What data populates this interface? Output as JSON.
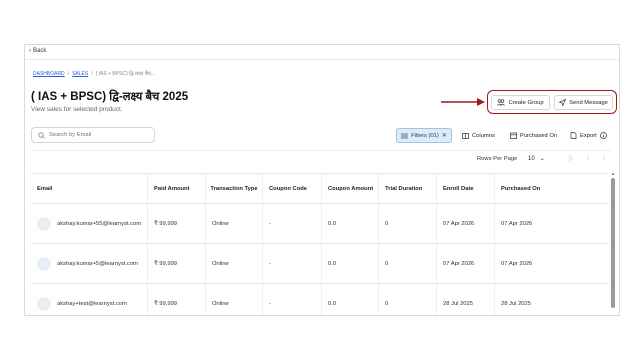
{
  "nav": {
    "back_label": "Back"
  },
  "breadcrumb": {
    "item1": "DASHBOARD",
    "sep1": "/",
    "item2": "SALES",
    "sep2": "/",
    "item3": "( IAS + BPSC) द्वि-लक्ष्य बैच..."
  },
  "page": {
    "title": "( IAS + BPSC) द्वि-लक्ष्य बैच 2025",
    "subtitle": "View sales for selected product."
  },
  "actions": {
    "create_group": "Create Group",
    "send_message": "Send Message"
  },
  "toolbar": {
    "search_placeholder": "Search by Email",
    "filters_label": "Filters (01)",
    "columns_label": "Columns",
    "purchased_on_label": "Purchased On",
    "export_label": "Export"
  },
  "pagination": {
    "rows_per_page_label": "Rows Per Page",
    "rows_per_page_value": "10"
  },
  "table": {
    "headers": [
      "Email",
      "Paid Amount",
      "Transaction Type",
      "Coupon Code",
      "Coupon Amount",
      "Trial Duration",
      "Enroll Date",
      "Purchased On"
    ],
    "rows": [
      {
        "email": "akshay.kumar+55@learnyst.com",
        "paid": "₹ 99,999",
        "type": "Online",
        "coupon": "-",
        "coupon_amount": "0.0",
        "trial": "0",
        "enroll": "07 Apr 2026",
        "purchased": "07 Apr 2026"
      },
      {
        "email": "akshay.kumar+5@learnyst.com",
        "paid": "₹ 99,999",
        "type": "Online",
        "coupon": "-",
        "coupon_amount": "0.0",
        "trial": "0",
        "enroll": "07 Apr 2026",
        "purchased": "07 Apr 2026"
      },
      {
        "email": "akshay+test@learnyst.com",
        "paid": "₹ 99,999",
        "type": "Online",
        "coupon": "-",
        "coupon_amount": "0.0",
        "trial": "0",
        "enroll": "28 Jul 2025",
        "purchased": "28 Jul 2025"
      }
    ]
  },
  "colors": {
    "accent_blue": "#2b5ce6",
    "highlight_red": "#9b1c1c",
    "filter_bg": "#deebf8"
  },
  "icons": [
    "chevron-left-icon",
    "group-icon",
    "send-icon",
    "search-icon",
    "filter-icon",
    "close-icon",
    "columns-icon",
    "calendar-icon",
    "export-icon",
    "info-icon",
    "chevron-down-icon",
    "first-page-icon",
    "prev-page-icon",
    "next-page-icon"
  ]
}
